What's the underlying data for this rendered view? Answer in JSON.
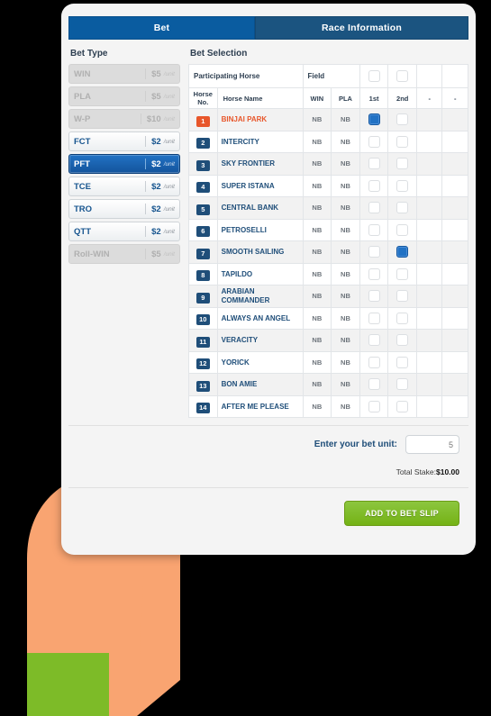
{
  "tabs": [
    {
      "label": "Bet",
      "active": true
    },
    {
      "label": "Race Information",
      "active": false
    }
  ],
  "bet_type": {
    "title": "Bet Type",
    "unit_suffix": "/unit",
    "items": [
      {
        "name": "WIN",
        "price": "$5",
        "state": "disabled"
      },
      {
        "name": "PLA",
        "price": "$5",
        "state": "disabled"
      },
      {
        "name": "W-P",
        "price": "$10",
        "state": "disabled"
      },
      {
        "name": "FCT",
        "price": "$2",
        "state": "normal"
      },
      {
        "name": "PFT",
        "price": "$2",
        "state": "selected"
      },
      {
        "name": "TCE",
        "price": "$2",
        "state": "normal"
      },
      {
        "name": "TRO",
        "price": "$2",
        "state": "normal"
      },
      {
        "name": "QTT",
        "price": "$2",
        "state": "normal"
      },
      {
        "name": "Roll-WIN",
        "price": "$5",
        "state": "disabled"
      }
    ]
  },
  "bet_selection": {
    "title": "Bet Selection",
    "field_row": {
      "participating_horse_label": "Participating Horse",
      "field_label": "Field",
      "checkboxes": [
        false,
        false
      ]
    },
    "columns": [
      "Horse No.",
      "Horse Name",
      "WIN",
      "PLA",
      "1st",
      "2nd",
      "-",
      "-"
    ],
    "rows": [
      {
        "no": "1",
        "name": "BINJAI PARK",
        "win": "NB",
        "pla": "NB",
        "first": true,
        "second": false,
        "highlight": true
      },
      {
        "no": "2",
        "name": "INTERCITY",
        "win": "NB",
        "pla": "NB",
        "first": false,
        "second": false,
        "highlight": false
      },
      {
        "no": "3",
        "name": "SKY FRONTIER",
        "win": "NB",
        "pla": "NB",
        "first": false,
        "second": false,
        "highlight": false
      },
      {
        "no": "4",
        "name": "SUPER ISTANA",
        "win": "NB",
        "pla": "NB",
        "first": false,
        "second": false,
        "highlight": false
      },
      {
        "no": "5",
        "name": "CENTRAL BANK",
        "win": "NB",
        "pla": "NB",
        "first": false,
        "second": false,
        "highlight": false
      },
      {
        "no": "6",
        "name": "PETROSELLI",
        "win": "NB",
        "pla": "NB",
        "first": false,
        "second": false,
        "highlight": false
      },
      {
        "no": "7",
        "name": "SMOOTH SAILING",
        "win": "NB",
        "pla": "NB",
        "first": false,
        "second": true,
        "highlight": false
      },
      {
        "no": "8",
        "name": "TAPILDO",
        "win": "NB",
        "pla": "NB",
        "first": false,
        "second": false,
        "highlight": false
      },
      {
        "no": "9",
        "name": "ARABIAN COMMANDER",
        "win": "NB",
        "pla": "NB",
        "first": false,
        "second": false,
        "highlight": false
      },
      {
        "no": "10",
        "name": "ALWAYS AN ANGEL",
        "win": "NB",
        "pla": "NB",
        "first": false,
        "second": false,
        "highlight": false
      },
      {
        "no": "11",
        "name": "VERACITY",
        "win": "NB",
        "pla": "NB",
        "first": false,
        "second": false,
        "highlight": false
      },
      {
        "no": "12",
        "name": "YORICK",
        "win": "NB",
        "pla": "NB",
        "first": false,
        "second": false,
        "highlight": false
      },
      {
        "no": "13",
        "name": "BON AMIE",
        "win": "NB",
        "pla": "NB",
        "first": false,
        "second": false,
        "highlight": false
      },
      {
        "no": "14",
        "name": "AFTER ME PLEASE",
        "win": "NB",
        "pla": "NB",
        "first": false,
        "second": false,
        "highlight": false
      }
    ]
  },
  "footer": {
    "unit_label": "Enter your bet unit:",
    "unit_value": "5",
    "unit_placeholder": "",
    "total_stake_label": "Total Stake:",
    "total_stake_value": "$10.00",
    "add_button_label": "ADD TO BET SLIP"
  },
  "colors": {
    "tab_active": "#0a5ca0",
    "tab_inactive": "#1b5480",
    "selected_bet": "#2272c4",
    "checkbox_on": "#2272c4",
    "highlight_horse": "#e8562a",
    "badge_navy": "#1f4e79",
    "add_button": "#8cc63f",
    "hand_skin": "#f9a471",
    "hand_sleeve": "#7dbb28"
  }
}
